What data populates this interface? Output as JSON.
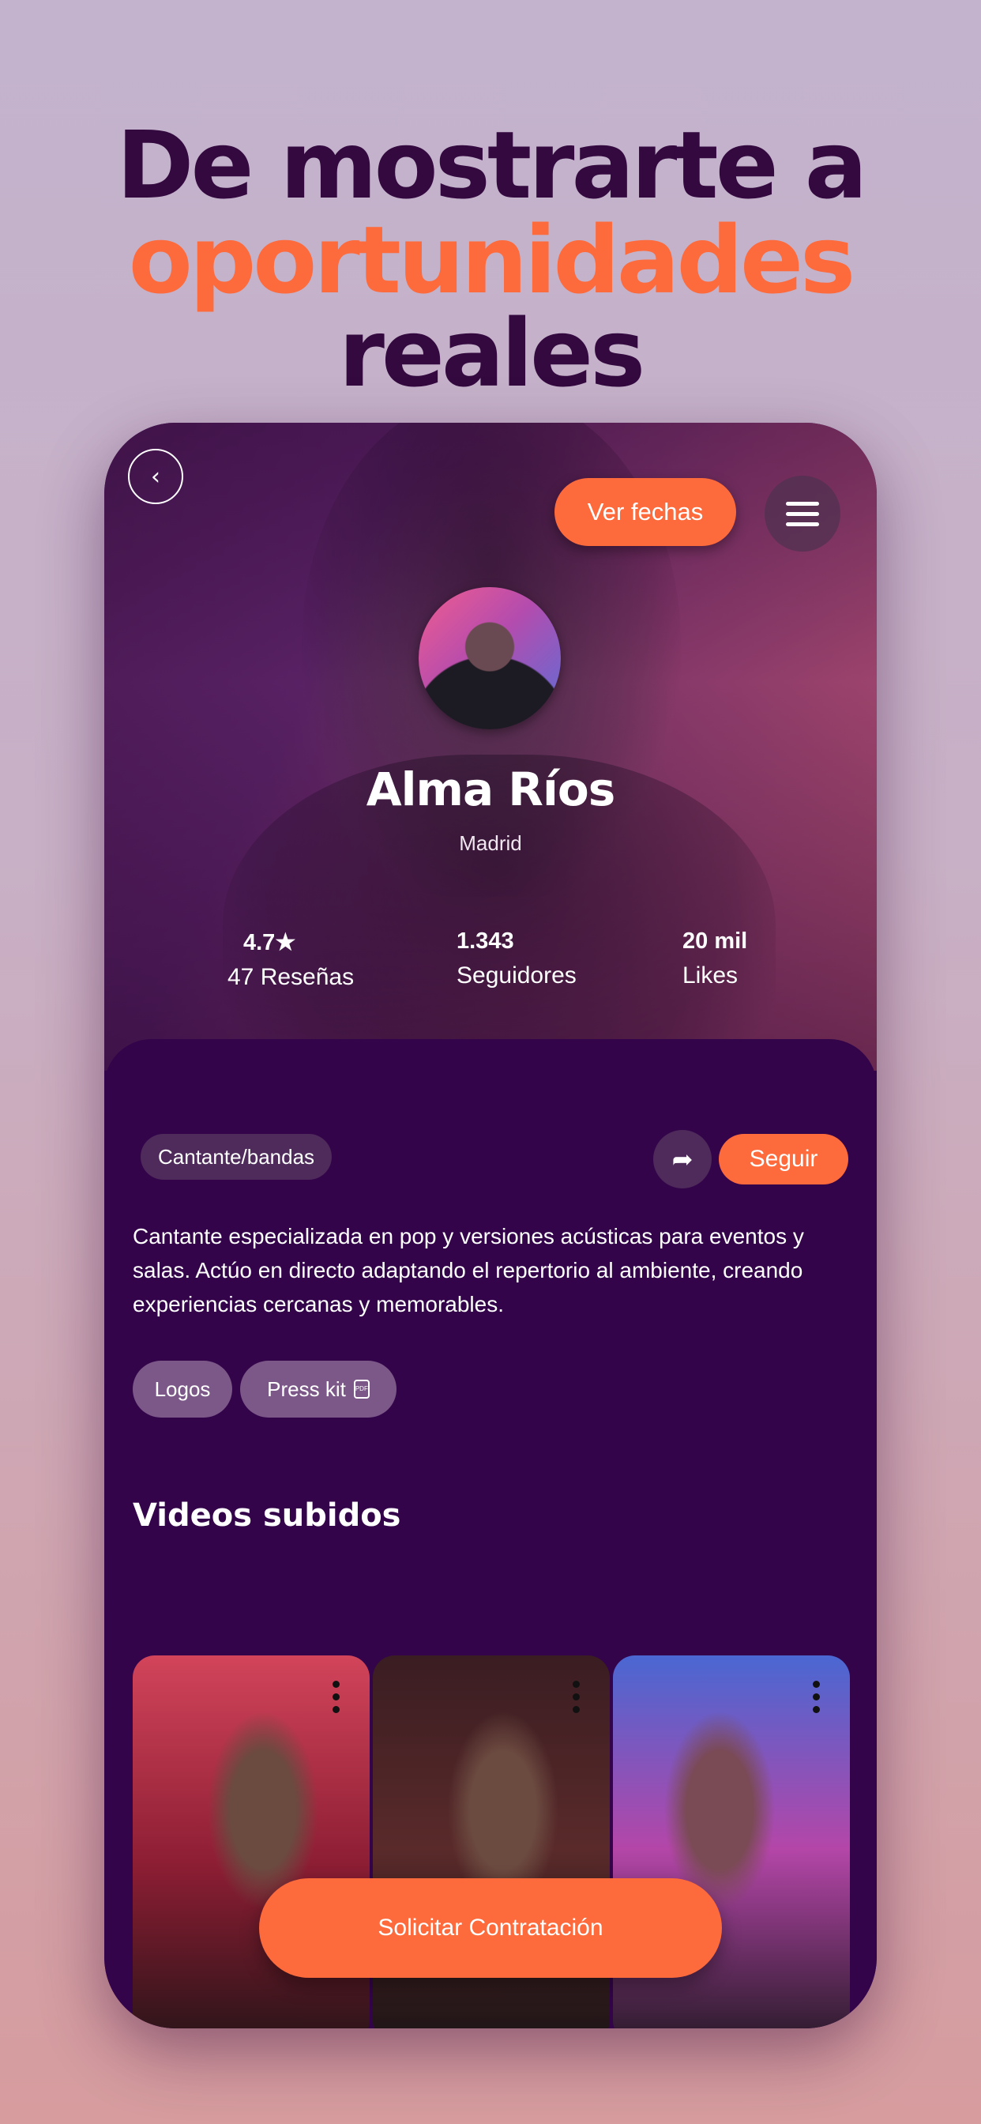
{
  "headline": {
    "line1": "De mostrarte a",
    "line2_accent": "oportunidades",
    "line2_rest": "reales",
    "text_color": "#33093f",
    "accent_color": "#fd6a3b"
  },
  "top_bar": {
    "back_icon": "chevron-left-icon",
    "dates_button": "Ver fechas",
    "menu_icon": "hamburger-menu-icon"
  },
  "profile": {
    "name": "Alma Ríos",
    "city": "Madrid",
    "stats": [
      {
        "value": "4.7★",
        "label": "47 Reseñas"
      },
      {
        "value": "1.343",
        "label": "Seguidores"
      },
      {
        "value": "20 mil",
        "label": "Likes"
      }
    ],
    "category_tag": "Cantante/bandas",
    "share_icon": "share-arrow-icon",
    "follow_button": "Seguir",
    "bio": "Cantante especializada en pop y versiones acústicas para eventos y salas. Actúo en directo adaptando el repertorio al ambiente, creando experiencias cercanas y memorables.",
    "documents": [
      {
        "label": "Logos"
      },
      {
        "label": "Press kit",
        "icon": "pdf-file-icon",
        "icon_text": "PDF"
      }
    ]
  },
  "videos": {
    "title": "Videos subidos",
    "items": [
      {
        "menu_icon": "more-vertical-icon"
      },
      {
        "menu_icon": "more-vertical-icon"
      },
      {
        "menu_icon": "more-vertical-icon"
      }
    ]
  },
  "cta": {
    "label": "Solicitar Contratación",
    "color": "#fd6a3b"
  },
  "colors": {
    "background": "#33044a",
    "chip": "#4e2b5b",
    "doc_chip": "#7c5888"
  }
}
